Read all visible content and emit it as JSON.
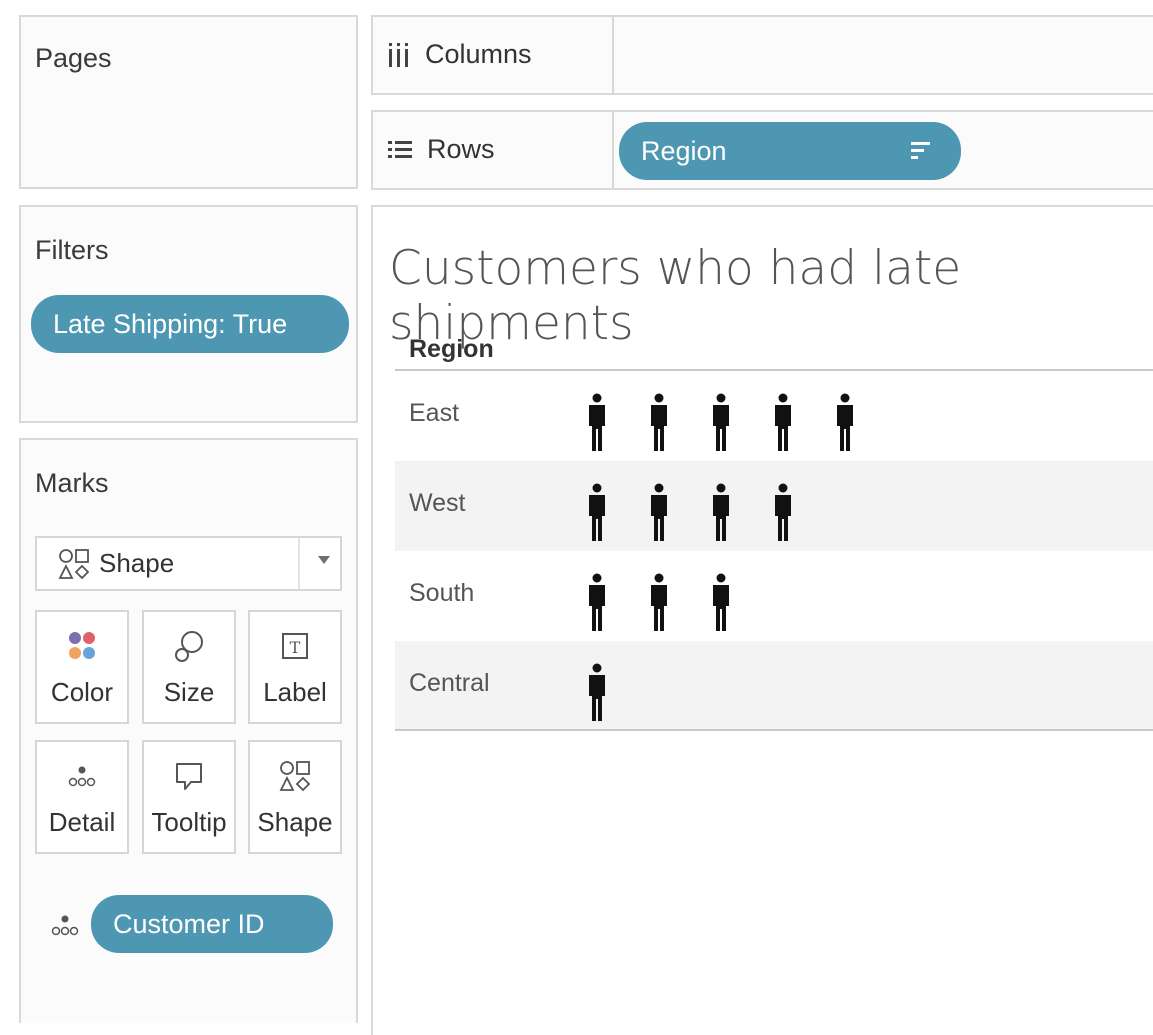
{
  "cards": {
    "pages_title": "Pages",
    "filters_title": "Filters",
    "marks_title": "Marks"
  },
  "filters": {
    "pill": "Late Shipping: True"
  },
  "marks": {
    "mark_type": "Shape",
    "buttons": {
      "color": "Color",
      "size": "Size",
      "label": "Label",
      "detail": "Detail",
      "tooltip": "Tooltip",
      "shape": "Shape"
    },
    "detail_pill": "Customer ID"
  },
  "shelves": {
    "columns_label": "Columns",
    "rows_label": "Rows",
    "rows_pill": "Region"
  },
  "view": {
    "title": "Customers who had late shipments",
    "column_header": "Region"
  },
  "chart_data": {
    "type": "table",
    "title": "Customers who had late shipments",
    "row_header": "Region",
    "categories": [
      "East",
      "West",
      "South",
      "Central"
    ],
    "values": [
      5,
      4,
      3,
      1
    ],
    "mark": "person-shape"
  },
  "colors": {
    "pill": "#4e97b2",
    "mark": "#111111",
    "band": "#f3f3f3"
  },
  "icons": {
    "columns": "columns-icon",
    "rows": "rows-icon",
    "sort": "sort-descending-icon",
    "shape": "shapes-icon",
    "color": "color-dots-icon",
    "size": "size-icon",
    "label": "text-label-icon",
    "detail": "detail-dots-icon",
    "tooltip": "tooltip-icon"
  }
}
